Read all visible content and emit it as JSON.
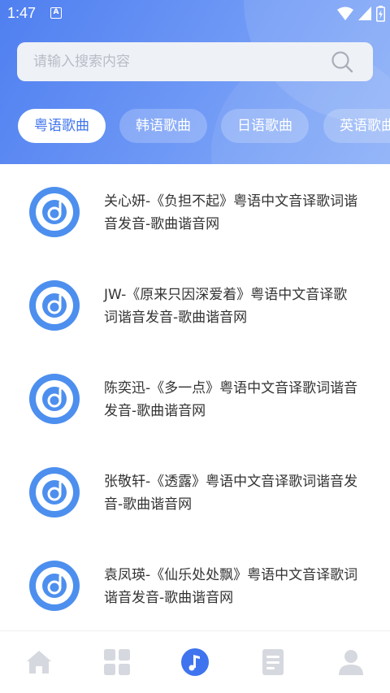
{
  "status_bar": {
    "time": "1:47",
    "notification": "A"
  },
  "search": {
    "placeholder": "请输入搜索内容",
    "value": ""
  },
  "tabs": [
    {
      "label": "粤语歌曲",
      "active": true
    },
    {
      "label": "韩语歌曲",
      "active": false
    },
    {
      "label": "日语歌曲",
      "active": false
    },
    {
      "label": "英语歌曲",
      "active": false
    }
  ],
  "songs": [
    {
      "title": "关心妍-《负担不起》粤语中文音译歌词谐音发音-歌曲谐音网"
    },
    {
      "title": "JW-《原来只因深爱着》粤语中文音译歌词谐音发音-歌曲谐音网"
    },
    {
      "title": "陈奕迅-《多一点》粤语中文音译歌词谐音发音-歌曲谐音网"
    },
    {
      "title": "张敬轩-《透露》粤语中文音译歌词谐音发音-歌曲谐音网"
    },
    {
      "title": "袁凤瑛-《仙乐处处飘》粤语中文音译歌词谐音发音-歌曲谐音网"
    }
  ],
  "nav": [
    {
      "icon": "home-icon",
      "active": false
    },
    {
      "icon": "grid-icon",
      "active": false
    },
    {
      "icon": "music-note-icon",
      "active": true
    },
    {
      "icon": "document-icon",
      "active": false
    },
    {
      "icon": "user-icon",
      "active": false
    }
  ],
  "colors": {
    "accent": "#3f74ee",
    "header_start": "#4f7ff0",
    "header_end": "#8cb0f8",
    "nav_inactive": "#d5d8de"
  }
}
